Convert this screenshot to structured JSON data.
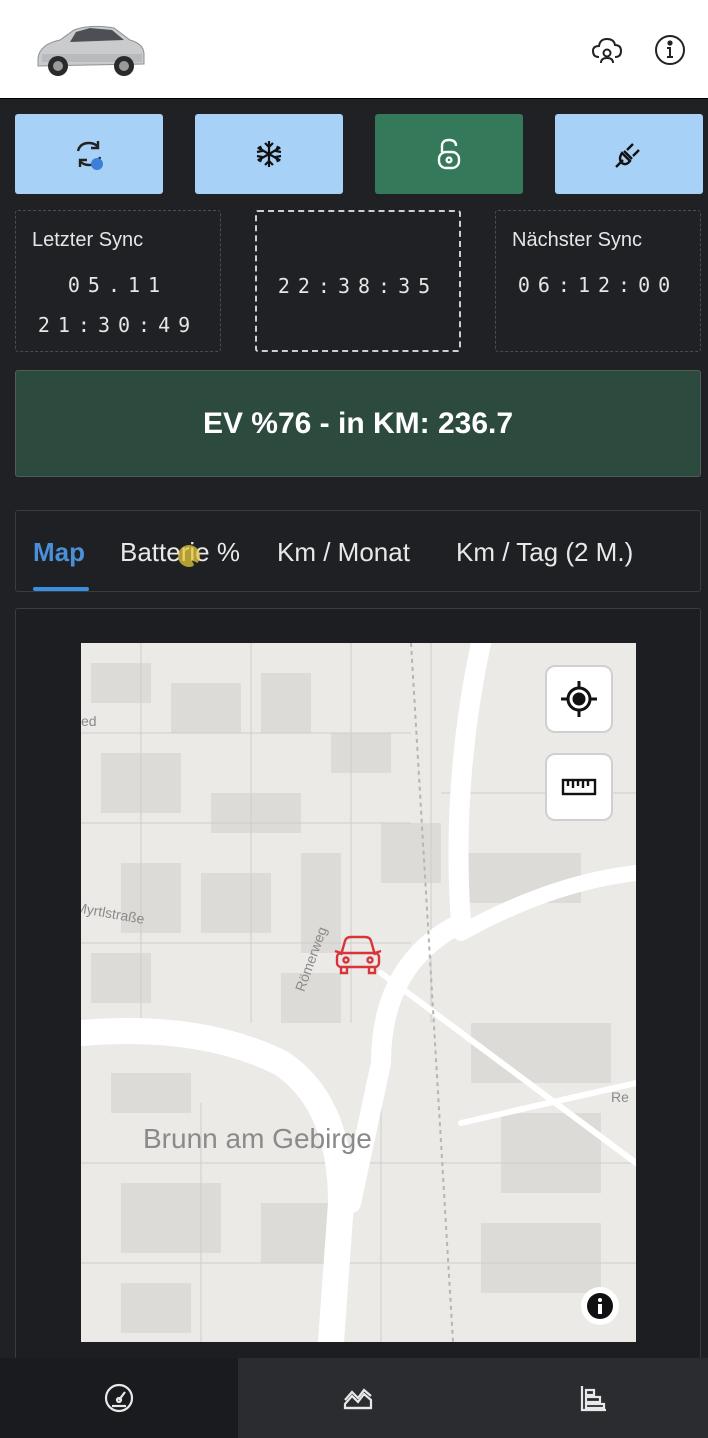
{
  "header": {
    "car_icon": "car-photo",
    "cloud_icon": "cloud-user-icon",
    "info_icon": "info-icon"
  },
  "actions": [
    {
      "name": "sync-button",
      "icon": "sync-icon",
      "bg": "#a7d1f7"
    },
    {
      "name": "climate-button",
      "icon": "snowflake-icon",
      "bg": "#a7d1f7"
    },
    {
      "name": "lock-button",
      "icon": "unlock-icon",
      "bg": "#34795a"
    },
    {
      "name": "charge-button",
      "icon": "plug-icon",
      "bg": "#a7d1f7"
    }
  ],
  "sync": {
    "last_label": "Letzter Sync",
    "last_date": "05.11",
    "last_time": "21:30:49",
    "current_time": "22:38:35",
    "next_label": "Nächster Sync",
    "next_time": "06:12:00"
  },
  "ev_status": "EV %76 - in KM: 236.7",
  "tabs": [
    {
      "label": "Map",
      "active": true
    },
    {
      "label": "Batterie %",
      "active": false
    },
    {
      "label": "Km / Monat",
      "active": false
    },
    {
      "label": "Km / Tag (2 M.)",
      "active": false
    }
  ],
  "map": {
    "place": "Brunn am Gebirge",
    "streets": [
      "Römerweg",
      "Myrtlstraße",
      "ed",
      "Re"
    ],
    "marker_icon": "car-marker-icon",
    "marker_color": "#d9343a"
  },
  "bottom_nav": [
    {
      "icon": "speedometer-icon",
      "active": true
    },
    {
      "icon": "area-chart-icon",
      "active": false
    },
    {
      "icon": "bar-chart-icon",
      "active": false
    }
  ],
  "colors": {
    "accent": "#3b8fe0",
    "banner": "#2d4a3e",
    "light_button": "#a7d1f7",
    "green_button": "#34795a"
  }
}
